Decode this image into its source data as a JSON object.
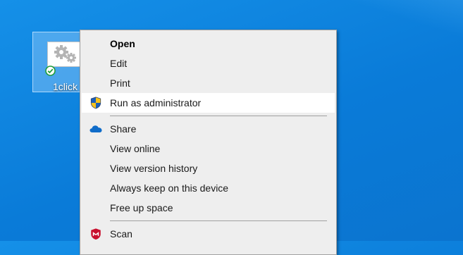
{
  "desktop": {
    "icon_label": "1click",
    "background_color": "#0a7bd8"
  },
  "context_menu": {
    "items": [
      {
        "label": "Open",
        "bold": true,
        "icon": null
      },
      {
        "label": "Edit",
        "bold": false,
        "icon": null
      },
      {
        "label": "Print",
        "bold": false,
        "icon": null
      },
      {
        "label": "Run as administrator",
        "bold": false,
        "icon": "uac-shield-icon",
        "highlighted": true
      },
      {
        "label": "Share",
        "bold": false,
        "icon": "onedrive-cloud-icon"
      },
      {
        "label": "View online",
        "bold": false,
        "icon": null
      },
      {
        "label": "View version history",
        "bold": false,
        "icon": null
      },
      {
        "label": "Always keep on this device",
        "bold": false,
        "icon": null
      },
      {
        "label": "Free up space",
        "bold": false,
        "icon": null
      },
      {
        "label": "Scan",
        "bold": false,
        "icon": "mcafee-icon"
      }
    ],
    "highlight_color": "#ffffff",
    "background_color": "#eeeeee"
  }
}
